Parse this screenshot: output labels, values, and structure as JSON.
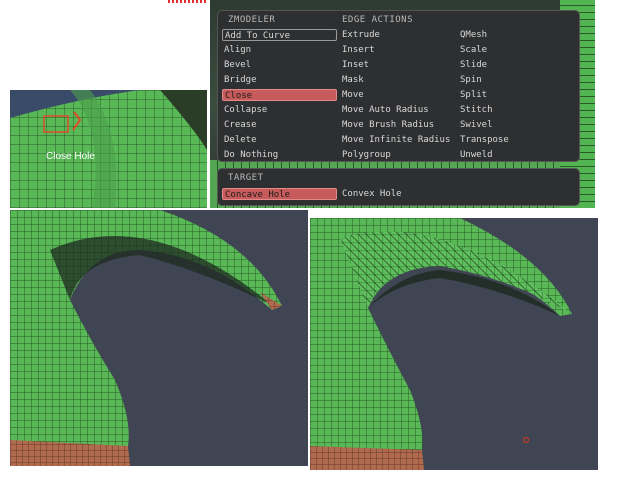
{
  "zmodeler_panel": {
    "headers": {
      "left": "ZMODELER",
      "right": "EDGE ACTIONS"
    },
    "col1": [
      "Add To Curve",
      "Align",
      "Bevel",
      "Bridge",
      "Close",
      "Collapse",
      "Crease",
      "Delete",
      "Do Nothing"
    ],
    "col2": [
      "Extrude",
      "Insert",
      "Inset",
      "Mask",
      "Move",
      "Move Auto Radius",
      "Move Brush Radius",
      "Move Infinite Radius",
      "Polygroup"
    ],
    "col3": [
      "QMesh",
      "Scale",
      "Slide",
      "Spin",
      "Split",
      "Stitch",
      "Swivel",
      "Transpose",
      "Unweld"
    ],
    "selected_action": "Close",
    "hovered_action": "Add To Curve"
  },
  "target_panel": {
    "header": "TARGET",
    "options": [
      "Concave Hole",
      "Convex Hole"
    ],
    "selected": "Concave Hole"
  },
  "inset_view": {
    "label": "Close Hole"
  },
  "colors": {
    "mesh_green": "#59b957",
    "mesh_line": "#2a5a2a",
    "edge_band": "#b06a4e",
    "viewport_bg": "#3f4552",
    "panel_bg": "#2e2f31",
    "selection_red": "#c75a5a"
  }
}
